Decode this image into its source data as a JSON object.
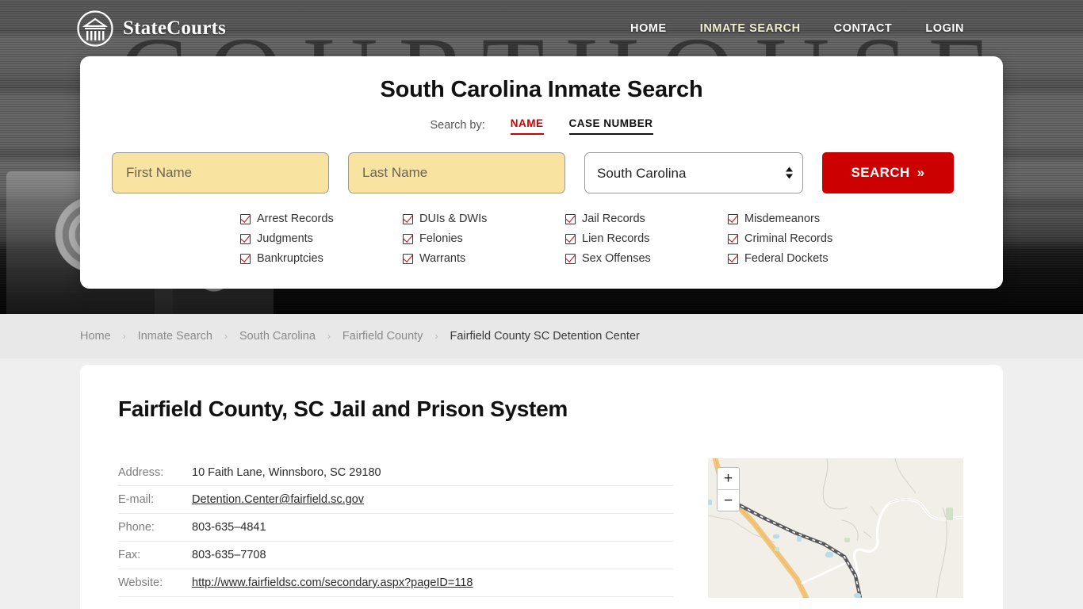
{
  "header": {
    "brand_name": "StateCourts",
    "brand_icon": "courthouse-circle-icon",
    "nav": [
      {
        "label": "HOME",
        "active": false
      },
      {
        "label": "INMATE SEARCH",
        "active": true
      },
      {
        "label": "CONTACT",
        "active": false
      },
      {
        "label": "LOGIN",
        "active": false
      }
    ]
  },
  "hero": {
    "background_word": "COURTHOUSE"
  },
  "search": {
    "title": "South Carolina Inmate Search",
    "search_by_label": "Search by:",
    "tabs": [
      {
        "label": "NAME",
        "active": true,
        "color": "#cc0000"
      },
      {
        "label": "CASE NUMBER",
        "active": false,
        "color": "#111111"
      }
    ],
    "first_name_placeholder": "First Name",
    "first_name_value": "",
    "last_name_placeholder": "Last Name",
    "last_name_value": "",
    "state_selected": "South Carolina",
    "state_options": [
      "South Carolina"
    ],
    "submit_label": "SEARCH",
    "submit_chevron": "»",
    "field_color": "#f9e3a0",
    "button_color": "#cc0000",
    "checkboxes": [
      "Arrest Records",
      "DUIs & DWIs",
      "Jail Records",
      "Misdemeanors",
      "Judgments",
      "Felonies",
      "Lien Records",
      "Criminal Records",
      "Bankruptcies",
      "Warrants",
      "Sex Offenses",
      "Federal Dockets"
    ]
  },
  "breadcrumb": {
    "separator": "›",
    "items": [
      {
        "label": "Home",
        "current": false
      },
      {
        "label": "Inmate Search",
        "current": false
      },
      {
        "label": "South Carolina",
        "current": false
      },
      {
        "label": "Fairfield County",
        "current": false
      },
      {
        "label": "Fairfield County SC Detention Center",
        "current": true
      }
    ]
  },
  "main": {
    "page_title": "Fairfield County, SC Jail and Prison System",
    "details": [
      {
        "label": "Address:",
        "value": "10 Faith Lane, Winnsboro, SC 29180",
        "link": false
      },
      {
        "label": "E-mail:",
        "value": "Detention.Center@fairfield.sc.gov",
        "link": true
      },
      {
        "label": "Phone:",
        "value": "803-635–4841",
        "link": false
      },
      {
        "label": "Fax:",
        "value": "803-635–7708",
        "link": false
      },
      {
        "label": "Website:",
        "value": "http://www.fairfieldsc.com/secondary.aspx?pageID=118",
        "link": true
      }
    ]
  },
  "map": {
    "zoom_in_label": "+",
    "zoom_out_label": "−",
    "background_color": "#f2efe9",
    "highway_color": "#f2c57c",
    "railroad_color": "#58585a",
    "road_color": "#ffffff"
  }
}
